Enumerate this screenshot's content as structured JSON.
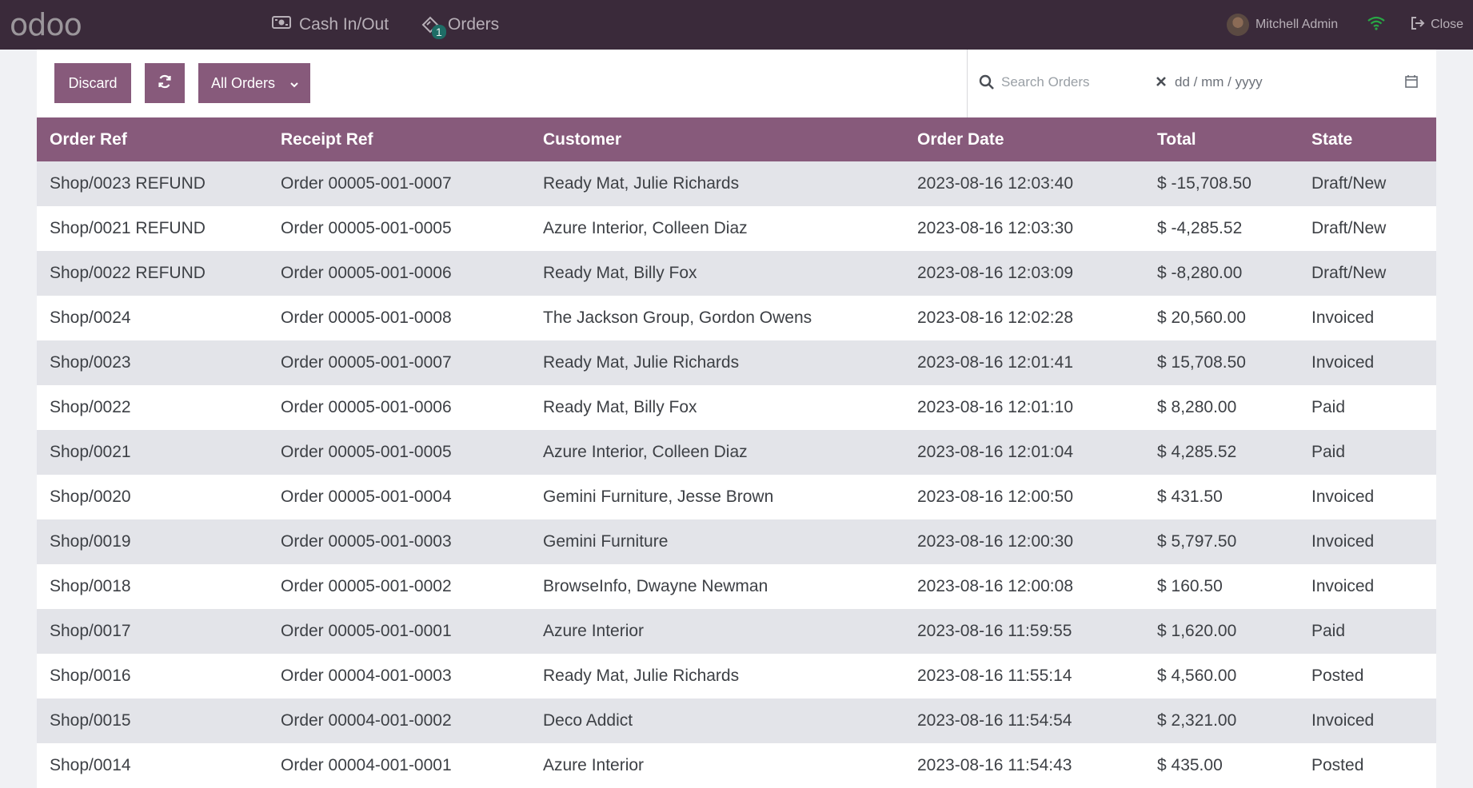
{
  "navbar": {
    "logo": "odoo",
    "cash_label": "Cash In/Out",
    "orders_label": "Orders",
    "orders_badge": "1",
    "user_name": "Mitchell Admin",
    "close_label": "Close"
  },
  "controls": {
    "discard_label": "Discard",
    "filter_label": "All Orders",
    "search_placeholder": "Search Orders",
    "date_placeholder": "dd / mm / yyyy"
  },
  "table": {
    "headers": [
      "Order Ref",
      "Receipt Ref",
      "Customer",
      "Order Date",
      "Total",
      "State"
    ],
    "rows": [
      [
        "Shop/0023 REFUND",
        "Order 00005-001-0007",
        "Ready Mat, Julie Richards",
        "2023-08-16 12:03:40",
        "$ -15,708.50",
        "Draft/New"
      ],
      [
        "Shop/0021 REFUND",
        "Order 00005-001-0005",
        "Azure Interior, Colleen Diaz",
        "2023-08-16 12:03:30",
        "$ -4,285.52",
        "Draft/New"
      ],
      [
        "Shop/0022 REFUND",
        "Order 00005-001-0006",
        "Ready Mat, Billy Fox",
        "2023-08-16 12:03:09",
        "$ -8,280.00",
        "Draft/New"
      ],
      [
        "Shop/0024",
        "Order 00005-001-0008",
        "The Jackson Group, Gordon Owens",
        "2023-08-16 12:02:28",
        "$ 20,560.00",
        "Invoiced"
      ],
      [
        "Shop/0023",
        "Order 00005-001-0007",
        "Ready Mat, Julie Richards",
        "2023-08-16 12:01:41",
        "$ 15,708.50",
        "Invoiced"
      ],
      [
        "Shop/0022",
        "Order 00005-001-0006",
        "Ready Mat, Billy Fox",
        "2023-08-16 12:01:10",
        "$ 8,280.00",
        "Paid"
      ],
      [
        "Shop/0021",
        "Order 00005-001-0005",
        "Azure Interior, Colleen Diaz",
        "2023-08-16 12:01:04",
        "$ 4,285.52",
        "Paid"
      ],
      [
        "Shop/0020",
        "Order 00005-001-0004",
        "Gemini Furniture, Jesse Brown",
        "2023-08-16 12:00:50",
        "$ 431.50",
        "Invoiced"
      ],
      [
        "Shop/0019",
        "Order 00005-001-0003",
        "Gemini Furniture",
        "2023-08-16 12:00:30",
        "$ 5,797.50",
        "Invoiced"
      ],
      [
        "Shop/0018",
        "Order 00005-001-0002",
        "BrowseInfo, Dwayne Newman",
        "2023-08-16 12:00:08",
        "$ 160.50",
        "Invoiced"
      ],
      [
        "Shop/0017",
        "Order 00005-001-0001",
        "Azure Interior",
        "2023-08-16 11:59:55",
        "$ 1,620.00",
        "Paid"
      ],
      [
        "Shop/0016",
        "Order 00004-001-0003",
        "Ready Mat, Julie Richards",
        "2023-08-16 11:55:14",
        "$ 4,560.00",
        "Posted"
      ],
      [
        "Shop/0015",
        "Order 00004-001-0002",
        "Deco Addict",
        "2023-08-16 11:54:54",
        "$ 2,321.00",
        "Invoiced"
      ],
      [
        "Shop/0014",
        "Order 00004-001-0001",
        "Azure Interior",
        "2023-08-16 11:54:43",
        "$ 435.00",
        "Posted"
      ]
    ]
  }
}
